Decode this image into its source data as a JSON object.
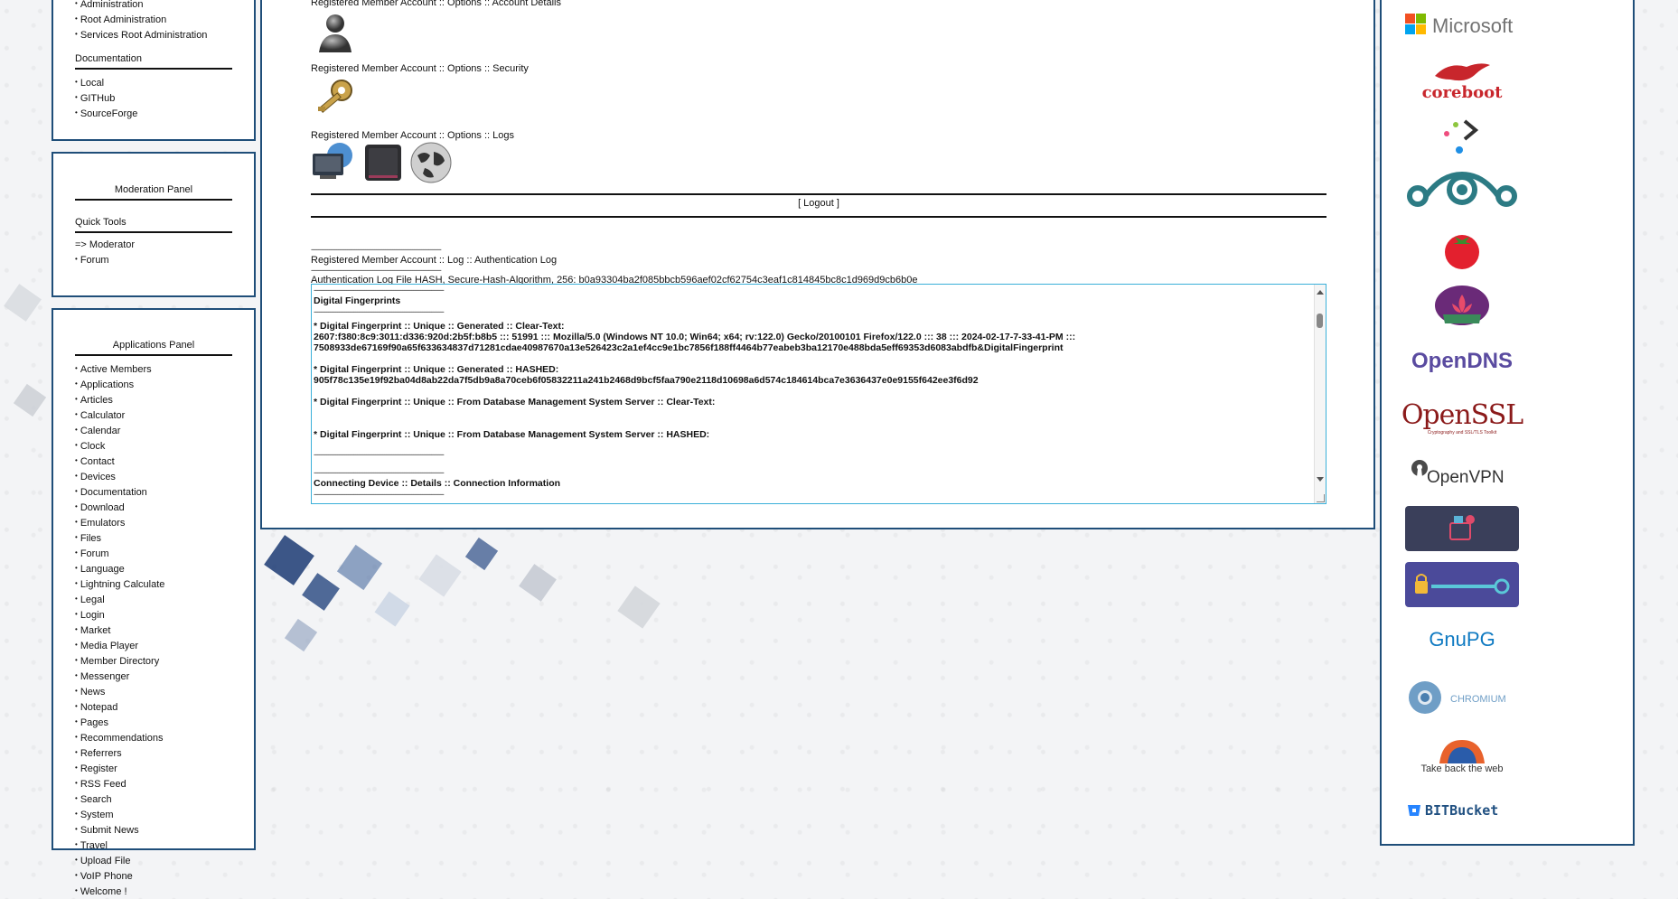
{
  "left_top": {
    "items_admin": [
      "Administration",
      "Root Administration",
      "Services Root Administration"
    ],
    "documentation_heading": "Documentation",
    "items_docs": [
      "Local",
      "GITHub",
      "SourceForge"
    ]
  },
  "moderation": {
    "title": "Moderation Panel",
    "quick_tools": "Quick Tools",
    "items": [
      "=> Moderator",
      "Forum"
    ]
  },
  "applications": {
    "title": "Applications Panel",
    "items": [
      "Active Members",
      "Applications",
      "Articles",
      "Calculator",
      "Calendar",
      "Clock",
      "Contact",
      "Devices",
      "Documentation",
      "Download",
      "Emulators",
      "Files",
      "Forum",
      "Language",
      "Lightning Calculate",
      "Legal",
      "Login",
      "Market",
      "Media Player",
      "Member Directory",
      "Messenger",
      "News",
      "Notepad",
      "Pages",
      "Recommendations",
      "Referrers",
      "Register",
      "RSS Feed",
      "Search",
      "System",
      "Submit News",
      "Travel",
      "Upload File",
      "VoIP Phone",
      "Welcome !"
    ]
  },
  "main": {
    "account_details_label": "Registered Member Account :: Options :: Account Details",
    "security_label": "Registered Member Account :: Options :: Security",
    "logs_label": "Registered Member Account :: Options :: Logs",
    "logout": "[ Logout ]",
    "dashes": "------------------------------------------------------------------------",
    "auth_log_label": "Registered Member Account :: Log :: Authentication Log",
    "hash_line": "Authentication Log File HASH, Secure-Hash-Algorithm, 256: b0a93304ba2f085bbcb596aef02cf62754c3eaf1c814845bc8c1d969d9cb6b0e",
    "log": {
      "heading1": "Digital Fingerprints",
      "clear_label": "* Digital Fingerprint :: Unique :: Generated :: Clear-Text:",
      "clear_line1": "2607:f380:8c9:3011:d336:920d:2b5f:b8b5 ::: 51991 ::: Mozilla/5.0 (Windows NT 10.0; Win64; x64; rv:122.0) Gecko/20100101 Firefox/122.0 ::: 38 ::: 2024-02-17-7-33-41-PM :::",
      "clear_line2": "7508933de67169f90a65f633634837d71281cdae40987670a13e526423c2a1ef4cc9e1bc7856f188ff4464b77eabeb3ba12170e488bda5eff69353d6083abdfb&DigitalFingerprint",
      "hashed_label": "* Digital Fingerprint :: Unique :: Generated :: HASHED:",
      "hashed_line": "905f78c135e19f92ba04d8ab22da7f5db9a8a70ceb6f05832211a241b2468d9bcf5faa790e2118d10698a6d574c184614bca7e3636437e0e9155f642ee3f6d92",
      "db_clear_label": "* Digital Fingerprint :: Unique :: From Database Management System Server :: Clear-Text:",
      "db_hashed_label": "* Digital Fingerprint :: Unique :: From Database Management System Server :: HASHED:",
      "heading2": "Connecting Device :: Details :: Connection Information"
    }
  },
  "logos": {
    "microsoft": "Microsoft",
    "coreboot": "coreboot",
    "opendns": "OpenDNS",
    "openssl": "OpenSSL",
    "openssl_tagline": "Cryptography and SSL/TLS Toolkit",
    "openvpn": "OpenVPN",
    "gnupg": "GnuPG",
    "chromium": "CHROMIUM",
    "firefox_tagline": "Take back the web",
    "bitbucket": "BITBucket"
  },
  "colors": {
    "panel_border": "#1f4e79",
    "textarea_border": "#3ab0d9",
    "opendns": "#5a4ba0",
    "openssl": "#8b1a1a"
  }
}
